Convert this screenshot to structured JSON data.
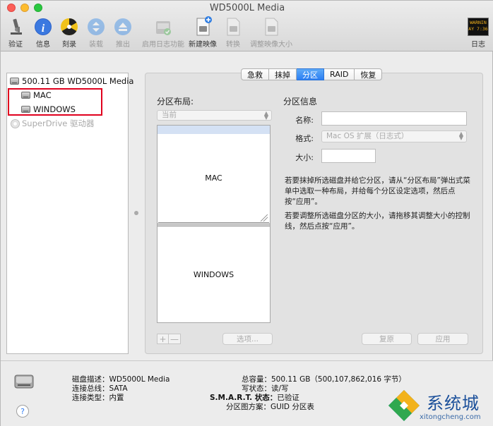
{
  "window": {
    "title": "WD5000L Media"
  },
  "toolbar": {
    "items": [
      {
        "label": "验证",
        "icon": "microscope-icon",
        "disabled": false
      },
      {
        "label": "信息",
        "icon": "info-icon",
        "disabled": false
      },
      {
        "label": "刻录",
        "icon": "burn-icon",
        "disabled": false
      },
      {
        "label": "装载",
        "icon": "mount-icon",
        "disabled": true
      },
      {
        "label": "推出",
        "icon": "eject-icon",
        "disabled": true
      },
      {
        "label": "启用日志功能",
        "icon": "journal-icon",
        "disabled": true
      },
      {
        "label": "新建映像",
        "icon": "new-image-icon",
        "disabled": false
      },
      {
        "label": "转换",
        "icon": "convert-icon",
        "disabled": true
      },
      {
        "label": "调整映像大小",
        "icon": "resize-image-icon",
        "disabled": true
      }
    ],
    "log": {
      "label": "日志",
      "icon_text": "WARNIN",
      "icon_text2": "AY 7:36"
    }
  },
  "sidebar": {
    "disk": "500.11 GB WD5000L Media",
    "partitions": [
      "MAC",
      "WINDOWS"
    ],
    "drive": "SuperDrive 驱动器"
  },
  "tabs": [
    {
      "label": "急救",
      "active": false
    },
    {
      "label": "抹掉",
      "active": false
    },
    {
      "label": "分区",
      "active": true
    },
    {
      "label": "RAID",
      "active": false
    },
    {
      "label": "恢复",
      "active": false
    }
  ],
  "layout": {
    "title": "分区布局:",
    "select_value": "当前",
    "partitions": [
      "MAC",
      "WINDOWS"
    ],
    "plus": "+",
    "minus": "—",
    "options_button": "选项..."
  },
  "info": {
    "title": "分区信息",
    "name_label": "名称:",
    "name_value": "",
    "format_label": "格式:",
    "format_value": "Mac OS 扩展（日志式）",
    "size_label": "大小:",
    "size_value": "",
    "help1": "若要抹掉所选磁盘并给它分区，请从“分区布局”弹出式菜单中选取一种布局，并给每个分区设定选项，然后点按“应用”。",
    "help2": "若要调整所选磁盘分区的大小，请拖移其调整大小的控制线，然后点按“应用”。",
    "revert_button": "复原",
    "apply_button": "应用"
  },
  "disk_info": {
    "desc_label": "磁盘描述：",
    "desc_value": "WD5000L Media",
    "bus_label": "连接总线：",
    "bus_value": "SATA",
    "type_label": "连接类型：",
    "type_value": "内置",
    "capacity_label": "总容量：",
    "capacity_value": "500.11 GB（500,107,862,016 字节）",
    "write_label": "写状态：",
    "write_value": "读/写",
    "smart_label": "S.M.A.R.T. 状态：",
    "smart_value": "已验证",
    "scheme_label": "分区图方案：",
    "scheme_value": "GUID 分区表"
  },
  "help_button": "?",
  "watermark": {
    "text": "系统城",
    "url": "xitongcheng.com"
  }
}
